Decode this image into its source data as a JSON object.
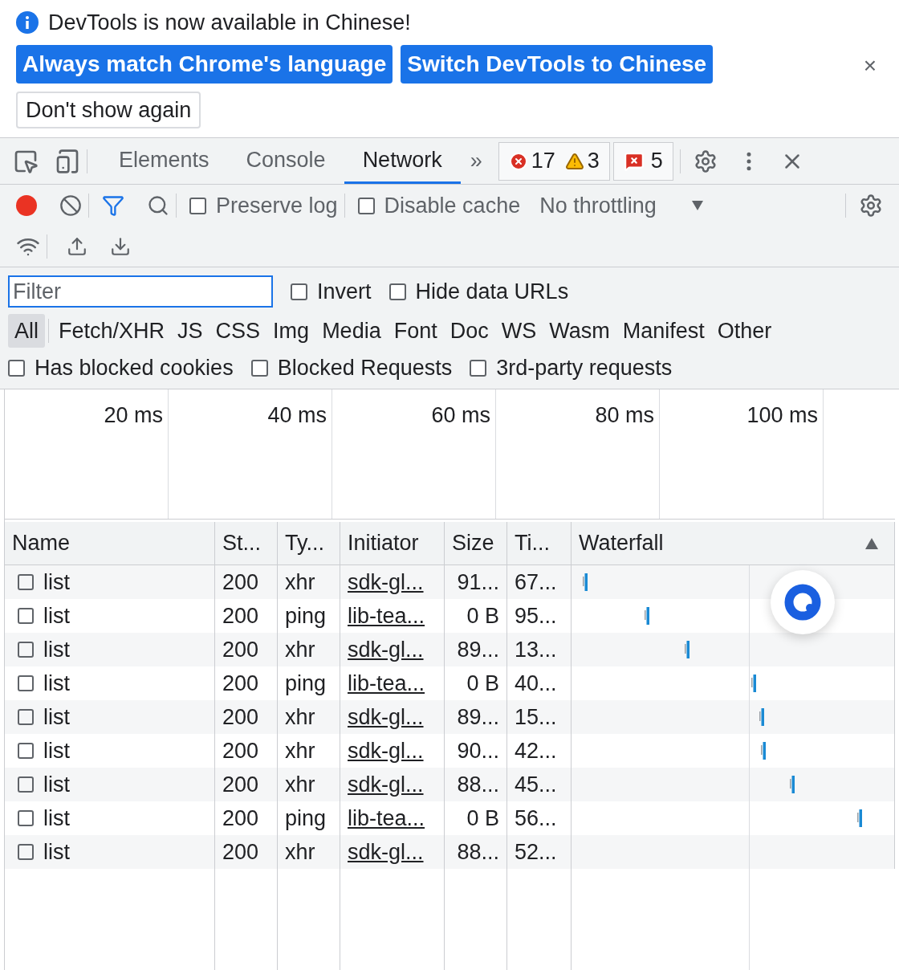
{
  "infobar": {
    "message": "DevTools is now available in Chinese!",
    "buttons": [
      {
        "label": "Always match Chrome's language",
        "kind": "primary"
      },
      {
        "label": "Switch DevTools to Chinese",
        "kind": "primary"
      },
      {
        "label": "Don't show again",
        "kind": "secondary"
      }
    ],
    "close": "×"
  },
  "tabs": [
    {
      "label": "Elements",
      "selected": false
    },
    {
      "label": "Console",
      "selected": false
    },
    {
      "label": "Network",
      "selected": true
    }
  ],
  "more_tabs": "»",
  "counters": {
    "errors": "17",
    "warnings": "3",
    "issues": "5"
  },
  "toolbar": {
    "recording": true,
    "options": [
      {
        "label": "Preserve log",
        "checked": false
      },
      {
        "label": "Disable cache",
        "checked": false
      }
    ],
    "throttling": "No throttling"
  },
  "filter": {
    "placeholder": "Filter",
    "options": [
      {
        "label": "Invert",
        "checked": false
      },
      {
        "label": "Hide data URLs",
        "checked": false
      }
    ]
  },
  "type_filters": [
    {
      "label": "All",
      "selected": true
    },
    {
      "label": "Fetch/XHR",
      "selected": false
    },
    {
      "label": "JS",
      "selected": false
    },
    {
      "label": "CSS",
      "selected": false
    },
    {
      "label": "Img",
      "selected": false
    },
    {
      "label": "Media",
      "selected": false
    },
    {
      "label": "Font",
      "selected": false
    },
    {
      "label": "Doc",
      "selected": false
    },
    {
      "label": "WS",
      "selected": false
    },
    {
      "label": "Wasm",
      "selected": false
    },
    {
      "label": "Manifest",
      "selected": false
    },
    {
      "label": "Other",
      "selected": false
    }
  ],
  "request_options": [
    {
      "label": "Has blocked cookies",
      "checked": false
    },
    {
      "label": "Blocked Requests",
      "checked": false
    },
    {
      "label": "3rd-party requests",
      "checked": false
    }
  ],
  "overview_ticks": [
    "20 ms",
    "40 ms",
    "60 ms",
    "80 ms",
    "100 ms"
  ],
  "table": {
    "columns": [
      "Name",
      "St...",
      "Ty...",
      "Initiator",
      "Size",
      "Ti...",
      "Waterfall"
    ],
    "rows": [
      {
        "checked": false,
        "name": "list",
        "status": "200",
        "type": "xhr",
        "initiator": "sdk-gl...",
        "size": "91...",
        "time": "67..."
      },
      {
        "checked": false,
        "name": "list",
        "status": "200",
        "type": "ping",
        "initiator": "lib-tea...",
        "size": "0 B",
        "time": "95..."
      },
      {
        "checked": false,
        "name": "list",
        "status": "200",
        "type": "xhr",
        "initiator": "sdk-gl...",
        "size": "89...",
        "time": "13..."
      },
      {
        "checked": false,
        "name": "list",
        "status": "200",
        "type": "ping",
        "initiator": "lib-tea...",
        "size": "0 B",
        "time": "40..."
      },
      {
        "checked": false,
        "name": "list",
        "status": "200",
        "type": "xhr",
        "initiator": "sdk-gl...",
        "size": "89...",
        "time": "15..."
      },
      {
        "checked": false,
        "name": "list",
        "status": "200",
        "type": "xhr",
        "initiator": "sdk-gl...",
        "size": "90...",
        "time": "42..."
      },
      {
        "checked": false,
        "name": "list",
        "status": "200",
        "type": "xhr",
        "initiator": "sdk-gl...",
        "size": "88...",
        "time": "45..."
      },
      {
        "checked": false,
        "name": "list",
        "status": "200",
        "type": "ping",
        "initiator": "lib-tea...",
        "size": "0 B",
        "time": "56..."
      },
      {
        "checked": false,
        "name": "list",
        "status": "200",
        "type": "xhr",
        "initiator": "sdk-gl...",
        "size": "88...",
        "time": "52..."
      }
    ]
  }
}
